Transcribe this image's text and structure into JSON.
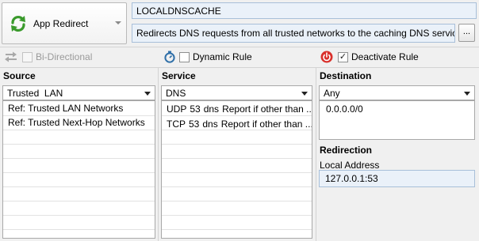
{
  "rule": {
    "type_label": "App Redirect",
    "name": "LOCALDNSCACHE",
    "description": "Redirects DNS requests from all trusted networks to the caching DNS service.",
    "more_button_label": "..."
  },
  "options": {
    "bidirectional": {
      "label": "Bi-Directional",
      "checked": false,
      "enabled": false
    },
    "dynamic_rule": {
      "label": "Dynamic Rule",
      "checked": false
    },
    "deactivate_rule": {
      "label": "Deactivate Rule",
      "checked": true
    }
  },
  "source": {
    "heading": "Source",
    "selected": "Trusted  LAN",
    "items": [
      "Ref: Trusted LAN Networks",
      "Ref: Trusted Next-Hop Networks"
    ]
  },
  "service": {
    "heading": "Service",
    "selected": "DNS",
    "items": [
      {
        "protocol": "UDP",
        "port": "53",
        "name": "dns",
        "note": "Report if other than ..."
      },
      {
        "protocol": "TCP",
        "port": "53",
        "name": "dns",
        "note": "Report if other than ..."
      }
    ]
  },
  "destination": {
    "heading": "Destination",
    "selected": "Any",
    "items": [
      "0.0.0.0/0"
    ]
  },
  "redirection": {
    "heading": "Redirection",
    "local_address_label": "Local Address",
    "local_address_value": "127.0.0.1:53"
  },
  "colors": {
    "field_bg": "#eaf1f9",
    "field_border": "#a8bfd9",
    "accent_green": "#3a9a2c",
    "accent_red": "#d9302b",
    "accent_blue": "#2f6fa8"
  }
}
